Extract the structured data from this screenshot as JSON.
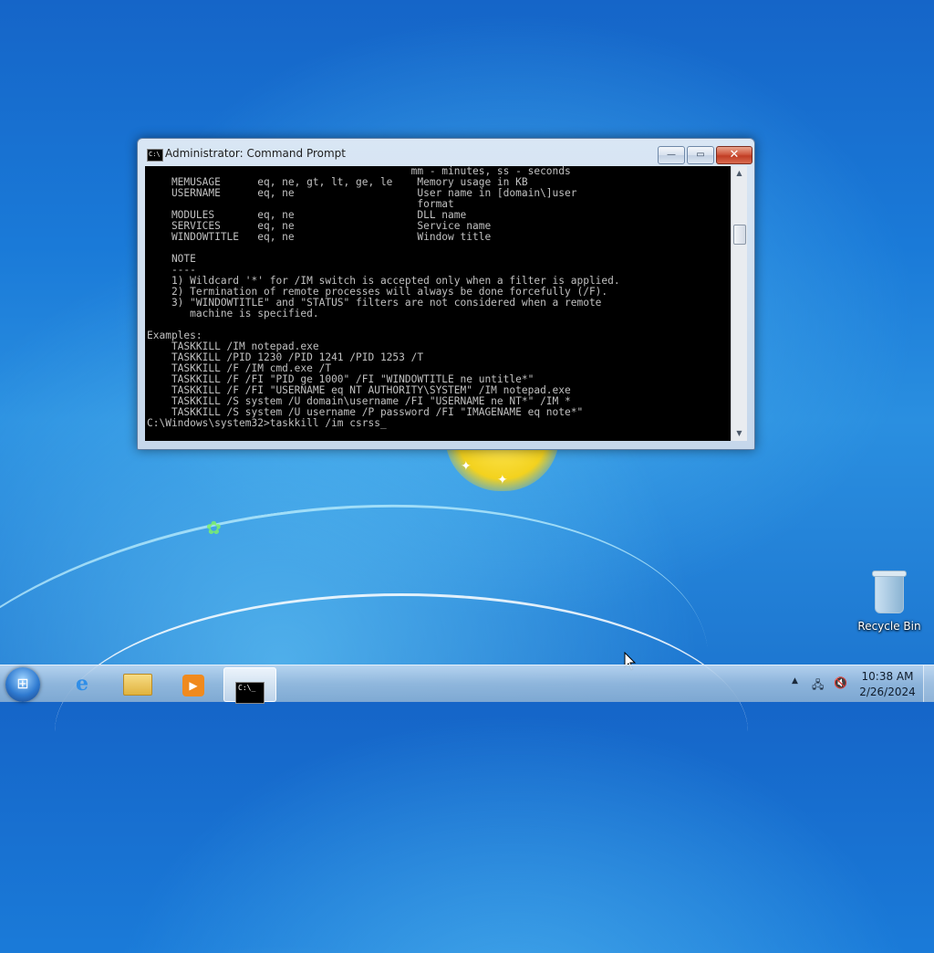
{
  "window": {
    "title": "Administrator:  Command Prompt",
    "console_lines": [
      "                                           mm - minutes, ss - seconds",
      "    MEMUSAGE      eq, ne, gt, lt, ge, le    Memory usage in KB",
      "    USERNAME      eq, ne                    User name in [domain\\]user",
      "                                            format",
      "    MODULES       eq, ne                    DLL name",
      "    SERVICES      eq, ne                    Service name",
      "    WINDOWTITLE   eq, ne                    Window title",
      "",
      "    NOTE",
      "    ----",
      "    1) Wildcard '*' for /IM switch is accepted only when a filter is applied.",
      "    2) Termination of remote processes will always be done forcefully (/F).",
      "    3) \"WINDOWTITLE\" and \"STATUS\" filters are not considered when a remote",
      "       machine is specified.",
      "",
      "Examples:",
      "    TASKKILL /IM notepad.exe",
      "    TASKKILL /PID 1230 /PID 1241 /PID 1253 /T",
      "    TASKKILL /F /IM cmd.exe /T",
      "    TASKKILL /F /FI \"PID ge 1000\" /FI \"WINDOWTITLE ne untitle*\"",
      "    TASKKILL /F /FI \"USERNAME eq NT AUTHORITY\\SYSTEM\" /IM notepad.exe",
      "    TASKKILL /S system /U domain\\username /FI \"USERNAME ne NT*\" /IM *",
      "    TASKKILL /S system /U username /P password /FI \"IMAGENAME eq note*\"",
      ""
    ],
    "prompt_line": "C:\\Windows\\system32>taskkill /im csrss",
    "cursor": "_",
    "controls": {
      "minimize": "—",
      "maximize": "▭",
      "close": "✕"
    },
    "icon_text": "C:\\"
  },
  "desktop": {
    "recycle_bin_label": "Recycle Bin"
  },
  "taskbar": {
    "start_glyph": "⊞",
    "pinned": [
      {
        "name": "internet-explorer",
        "glyph": "e"
      },
      {
        "name": "windows-explorer",
        "glyph": ""
      },
      {
        "name": "media-player",
        "glyph": "▶"
      },
      {
        "name": "command-prompt",
        "glyph": "C:\\_"
      }
    ],
    "tray": {
      "show_hidden_glyph": "▲",
      "network_glyph": "🖧",
      "volume_glyph": "🔇"
    },
    "clock": {
      "time": "10:38 AM",
      "date": "2/26/2024"
    }
  },
  "colors": {
    "console_bg": "#000000",
    "console_fg": "#c0c0c0",
    "close_button": "#c13d24"
  }
}
